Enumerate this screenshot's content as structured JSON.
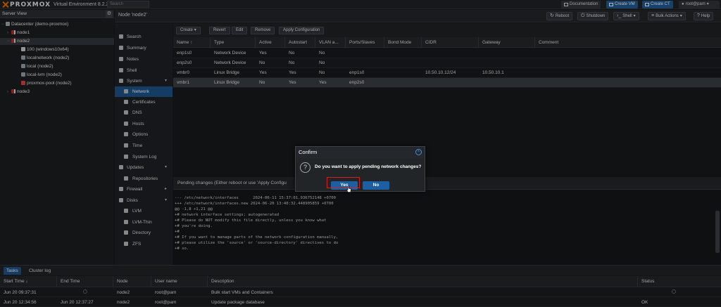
{
  "app": {
    "brand": "PROXMOX",
    "version": "Virtual Environment 8.2.2",
    "search_placeholder": "Search"
  },
  "top_buttons": {
    "documentation": "Documentation",
    "create_vm": "Create VM",
    "create_ct": "Create CT",
    "user": "root@pam"
  },
  "server_view": {
    "label": "Server View"
  },
  "tree": [
    {
      "label": "Datacenter (demo-proxmox)",
      "type": "dc"
    },
    {
      "label": "node1",
      "type": "node"
    },
    {
      "label": "node2",
      "type": "node"
    },
    {
      "label": "100 (windows10x64)",
      "type": "vm"
    },
    {
      "label": "localnetwork (node2)",
      "type": "store"
    },
    {
      "label": "local (node2)",
      "type": "store"
    },
    {
      "label": "local-lvm (node2)",
      "type": "store"
    },
    {
      "label": "proxmox-pool (node2)",
      "type": "pool"
    },
    {
      "label": "node3",
      "type": "node"
    }
  ],
  "node_header": {
    "title": "Node 'node2'",
    "reboot": "Reboot",
    "shutdown": "Shutdown",
    "shell": "Shell",
    "bulk_actions": "Bulk Actions",
    "help": "Help"
  },
  "menu": [
    {
      "label": "Search",
      "icon": "search-icon"
    },
    {
      "label": "Summary",
      "icon": "summary-icon"
    },
    {
      "label": "Notes",
      "icon": "notes-icon"
    },
    {
      "label": "Shell",
      "icon": "shell-icon"
    },
    {
      "label": "System",
      "icon": "gears-icon"
    },
    {
      "label": "Network",
      "icon": "network-icon"
    },
    {
      "label": "Certificates",
      "icon": "certificate-icon"
    },
    {
      "label": "DNS",
      "icon": "globe-icon"
    },
    {
      "label": "Hosts",
      "icon": "hosts-icon"
    },
    {
      "label": "Options",
      "icon": "gear-icon"
    },
    {
      "label": "Time",
      "icon": "clock-icon"
    },
    {
      "label": "System Log",
      "icon": "list-icon"
    },
    {
      "label": "Updates",
      "icon": "refresh-icon"
    },
    {
      "label": "Repositories",
      "icon": "repository-icon"
    },
    {
      "label": "Firewall",
      "icon": "shield-icon"
    },
    {
      "label": "Disks",
      "icon": "disk-icon"
    },
    {
      "label": "LVM",
      "icon": "lvm-icon"
    },
    {
      "label": "LVM-Thin",
      "icon": "lvm-thin-icon"
    },
    {
      "label": "Directory",
      "icon": "folder-icon"
    },
    {
      "label": "ZFS",
      "icon": "zfs-icon"
    }
  ],
  "network_toolbar": {
    "create": "Create",
    "revert": "Revert",
    "edit": "Edit",
    "remove": "Remove",
    "apply": "Apply Configuration"
  },
  "network_table": {
    "headers": [
      "Name ↑",
      "Type",
      "Active",
      "Autostart",
      "VLAN a...",
      "Ports/Slaves",
      "Bond Mode",
      "CIDR",
      "Gateway",
      "Comment"
    ],
    "rows": [
      [
        "enp1s0",
        "Network Device",
        "Yes",
        "No",
        "No",
        "",
        "",
        "",
        "",
        ""
      ],
      [
        "enp2s0",
        "Network Device",
        "No",
        "No",
        "No",
        "",
        "",
        "",
        "",
        ""
      ],
      [
        "vmbr0",
        "Linux Bridge",
        "Yes",
        "Yes",
        "No",
        "enp1s0",
        "",
        "10.50.10.12/24",
        "10.50.10.1",
        ""
      ],
      [
        "vmbr1",
        "Linux Bridge",
        "No",
        "Yes",
        "Yes",
        "enp2s0",
        "",
        "",
        "",
        ""
      ]
    ]
  },
  "pending": {
    "header": "Pending changes (Either reboot or use 'Apply Configu",
    "diff": "--- /etc/network/interfaces      2024-06-11 15:37:01.936752148 +0700\n+++ /etc/network/interfaces.new 2024-06-20 13:40:32.448905859 +0700\n@@ -1,8 +1,21 @@\n+# network interface settings; autogenerated\n+# Please do NOT modify this file directly, unless you know what\n+# you're doing.\n+#\n+# If you want to manage parts of the network configuration manually,\n+# please utilize the 'source' or 'source-directory' directives to do\n+# so."
  },
  "dialog": {
    "title": "Confirm",
    "message": "Do you want to apply pending network changes?",
    "yes": "Yes",
    "no": "No"
  },
  "bottom": {
    "tabs": [
      "Tasks",
      "Cluster log"
    ],
    "headers": [
      "Start Time ↓",
      "End Time",
      "Node",
      "User name",
      "Description",
      "Status"
    ],
    "rows": [
      {
        "start": "Jun 20 09:37:31",
        "end": "",
        "node": "node2",
        "user": "root@pam",
        "desc": "Bulk start VMs and Containers",
        "status": ""
      },
      {
        "start": "Jun 20 12:34:56",
        "end": "Jun 20 12:37:27",
        "node": "node2",
        "user": "root@pam",
        "desc": "Update package database",
        "status": "OK"
      }
    ]
  },
  "colors": {
    "accent": "#1e5489",
    "brand_orange": "#e57000",
    "highlight": "#d81f1f"
  }
}
